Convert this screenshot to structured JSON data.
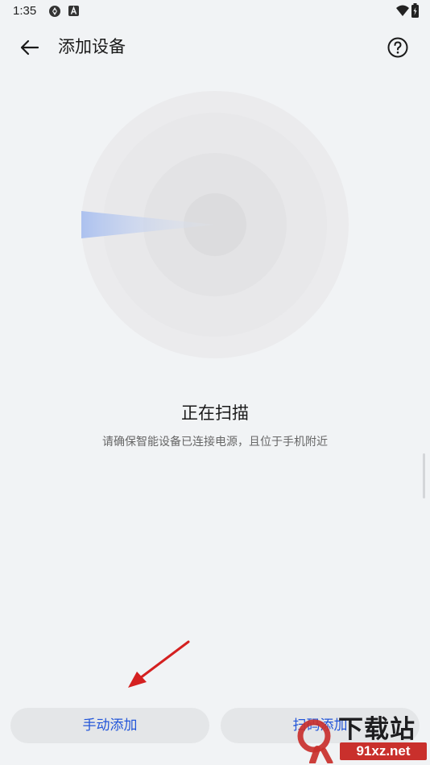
{
  "status_bar": {
    "time": "1:35",
    "icons": [
      "aperture-icon",
      "a-badge-icon",
      "wifi-icon",
      "battery-charging-icon"
    ]
  },
  "header": {
    "title": "添加设备",
    "back_icon": "arrow-left-icon",
    "help_icon": "question-circle-icon"
  },
  "scan": {
    "title": "正在扫描",
    "subtitle": "请确保智能设备已连接电源，且位于手机附近"
  },
  "actions": {
    "manual_add_label": "手动添加",
    "scan_qr_label": "扫码添加"
  },
  "watermark": {
    "title": "下载站",
    "url": "91xz.net"
  },
  "colors": {
    "background": "#f1f3f5",
    "accent": "#2356d9",
    "button_bg": "#e4e6e8",
    "arrow": "#d42020",
    "watermark_red": "#c9302c"
  }
}
